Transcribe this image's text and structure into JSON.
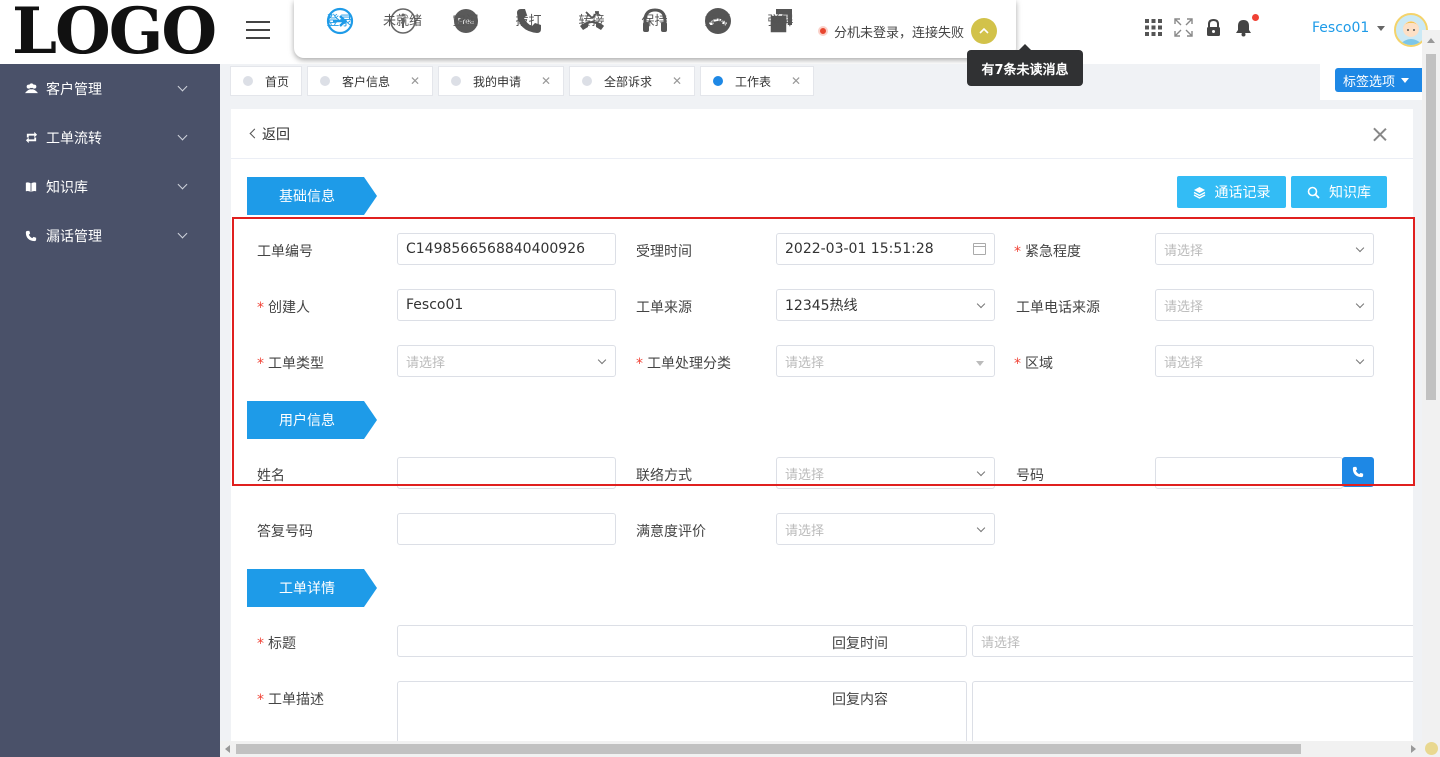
{
  "logo": {
    "text": "LOGO"
  },
  "sidebar": {
    "items": [
      {
        "label": "客户管理",
        "icon": "users-icon"
      },
      {
        "label": "工单流转",
        "icon": "refresh-icon"
      },
      {
        "label": "知识库",
        "icon": "book-icon"
      },
      {
        "label": "漏话管理",
        "icon": "phone-icon"
      }
    ]
  },
  "phonebar": {
    "buttons": [
      {
        "label": "登录",
        "icon": "login-icon",
        "active": true
      },
      {
        "label": "未就绪",
        "icon": "info-icon"
      },
      {
        "label": "空闲",
        "icon": "free-icon",
        "badge": "Free"
      },
      {
        "label": "拨打",
        "icon": "phone-dial-icon"
      },
      {
        "label": "转接",
        "icon": "transfer-icon"
      },
      {
        "label": "保持",
        "icon": "headset-icon"
      },
      {
        "label": "挂断",
        "icon": "hangup-icon"
      },
      {
        "label": "弹屏",
        "icon": "popup-icon"
      }
    ],
    "status": "分机未登录，连接失败"
  },
  "header": {
    "username": "Fesco01",
    "tooltip": "有7条未读消息"
  },
  "tabs": [
    {
      "label": "首页",
      "closable": false
    },
    {
      "label": "客户信息",
      "closable": true
    },
    {
      "label": "我的申请",
      "closable": true
    },
    {
      "label": "全部诉求",
      "closable": true
    },
    {
      "label": "工作表",
      "closable": true,
      "active": true
    }
  ],
  "tag_options": "标签选项",
  "card": {
    "back": "返回",
    "buttons": {
      "call_records": "通话记录",
      "knowledge": "知识库"
    },
    "sections": {
      "basic": "基础信息",
      "user": "用户信息",
      "detail": "工单详情"
    },
    "placeholder": "请选择",
    "fields": {
      "order_no": {
        "label": "工单编号",
        "value": "C1498566568840400926"
      },
      "accept_time": {
        "label": "受理时间",
        "value": "2022-03-01 15:51:28"
      },
      "urgency": {
        "label": "紧急程度"
      },
      "creator": {
        "label": "创建人",
        "value": "Fesco01"
      },
      "source": {
        "label": "工单来源",
        "value": "12345热线"
      },
      "phone_source": {
        "label": "工单电话来源"
      },
      "type": {
        "label": "工单类型"
      },
      "handle_category": {
        "label": "工单处理分类"
      },
      "region": {
        "label": "区域"
      },
      "name": {
        "label": "姓名"
      },
      "contact": {
        "label": "联络方式"
      },
      "number": {
        "label": "号码"
      },
      "reply_number": {
        "label": "答复号码"
      },
      "satisfaction": {
        "label": "满意度评价"
      },
      "title": {
        "label": "标题"
      },
      "reply_time": {
        "label": "回复时间"
      },
      "description": {
        "label": "工单描述"
      },
      "reply_content": {
        "label": "回复内容"
      }
    }
  }
}
